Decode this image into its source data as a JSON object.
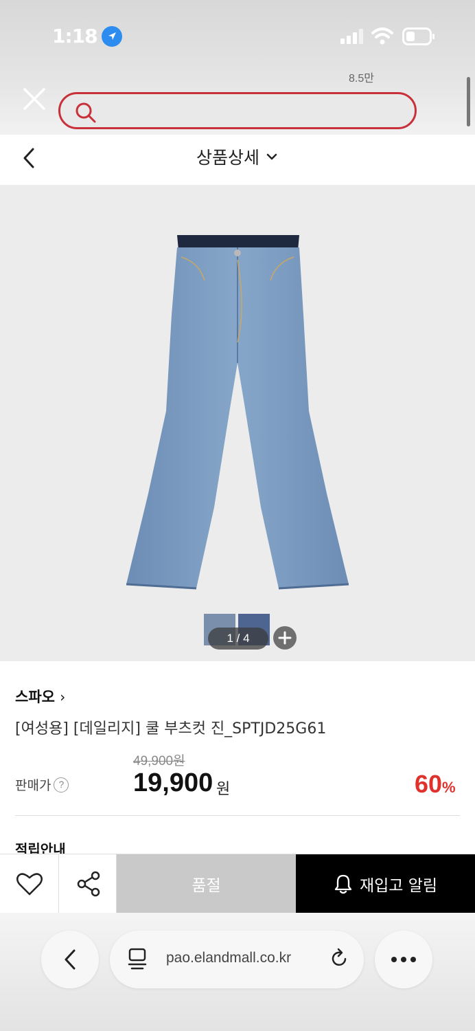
{
  "status_bar": {
    "time": "1:18",
    "icons": [
      "location-arrow-icon",
      "signal-icon",
      "wifi-icon",
      "battery-icon"
    ]
  },
  "header": {
    "view_count": "8.5만",
    "search": {
      "placeholder": "",
      "value": ""
    }
  },
  "page": {
    "title": "상품상세"
  },
  "gallery": {
    "pager": "1 / 4",
    "thumbnail_colors": [
      "#7a8fac",
      "#4d6590"
    ]
  },
  "product": {
    "brand": "스파오",
    "name": "[여성용] [데일리지] 쿨 부츠컷 진_SPTJD25G61",
    "original_price": "49,900원",
    "price_label": "판매가",
    "sale_price": "19,900",
    "currency": "원",
    "discount_value": "60",
    "discount_unit": "%",
    "points_info": "적립안내"
  },
  "actions": {
    "sold_out_label": "품절",
    "restock_label": "재입고 알림"
  },
  "browser": {
    "url": "pao.elandmall.co.kr"
  },
  "colors": {
    "accent_red": "#e0322d",
    "search_border": "#c8303a",
    "restock_bg": "#000000",
    "soldout_bg": "#c9c9c9"
  }
}
